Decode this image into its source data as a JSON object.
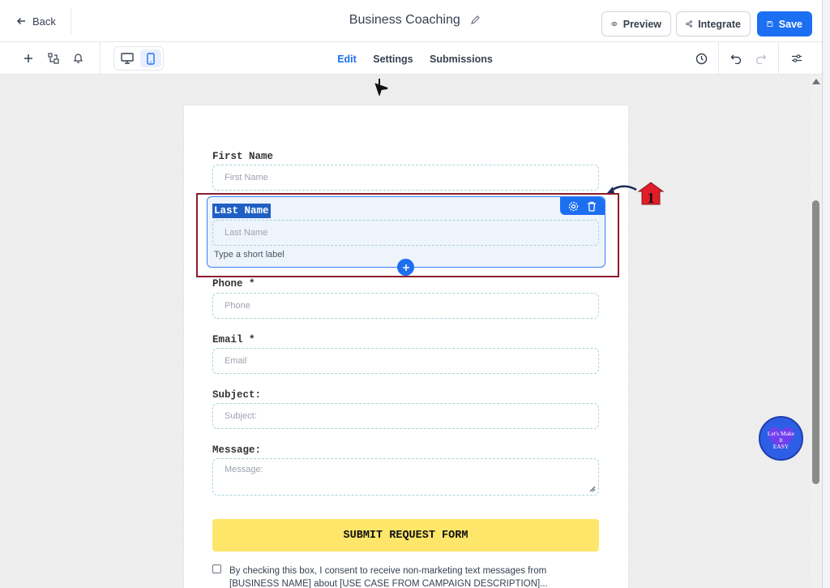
{
  "header": {
    "back_label": "Back",
    "title": "Business Coaching",
    "preview_label": "Preview",
    "integrate_label": "Integrate",
    "save_label": "Save"
  },
  "toolbar": {
    "tabs": [
      {
        "label": "Edit",
        "active": true
      },
      {
        "label": "Settings",
        "active": false
      },
      {
        "label": "Submissions",
        "active": false
      }
    ],
    "device_selected": "mobile"
  },
  "form": {
    "fields": [
      {
        "label": "First Name",
        "placeholder": "First Name"
      },
      {
        "label": "Last Name",
        "placeholder": "Last Name",
        "selected": true,
        "short_label_placeholder": "Type a short label"
      },
      {
        "label": "Phone *",
        "placeholder": "Phone"
      },
      {
        "label": "Email *",
        "placeholder": "Email"
      },
      {
        "label": "Subject:",
        "placeholder": "Subject:"
      },
      {
        "label": "Message:",
        "placeholder": "Message:"
      }
    ],
    "submit_label": "SUBMIT REQUEST FORM",
    "consent_text": "By checking this box, I consent to receive non-marketing text messages from [BUSINESS NAME] about [USE CASE FROM CAMPAIGN DESCRIPTION]..."
  },
  "annotation": {
    "number": "1"
  },
  "badge": {
    "line1": "Let's Make",
    "line2": "It",
    "line3": "EASY"
  },
  "colors": {
    "accent": "#1d6ff2",
    "submit": "#fde66a",
    "highlight": "#8b1c2b",
    "field_border": "#a8d5dc"
  }
}
